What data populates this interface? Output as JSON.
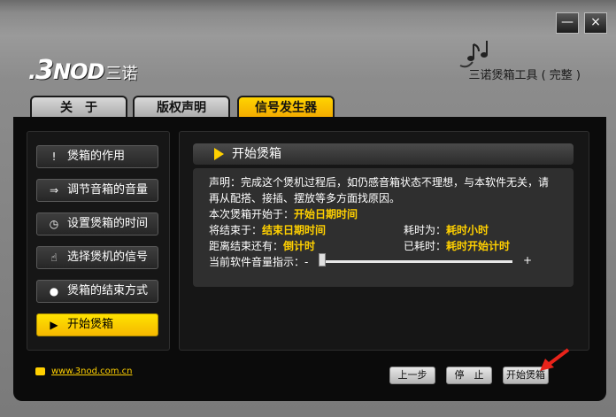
{
  "window": {
    "minimize_label": "—",
    "close_label": "×"
  },
  "logo": {
    "brand_prefix": ".",
    "brand_digit": "3",
    "brand_suffix": "NOD",
    "brand_cn": "三诺"
  },
  "app_title": "三诺煲箱工具 ( 完整 )",
  "tabs": [
    {
      "label": "关　于",
      "active": false
    },
    {
      "label": "版权声明",
      "active": false
    },
    {
      "label": "信号发生器",
      "active": true
    }
  ],
  "sidebar": {
    "items": [
      {
        "icon": "!",
        "label": "煲箱的作用"
      },
      {
        "icon": "⇒",
        "label": "调节音箱的音量"
      },
      {
        "icon": "◷",
        "label": "设置煲箱的时间"
      },
      {
        "icon": "☝",
        "label": "选择煲机的信号"
      },
      {
        "icon": "●",
        "label": "煲箱的结束方式"
      },
      {
        "icon": "▶",
        "label": "开始煲箱"
      }
    ]
  },
  "section": {
    "title": "开始煲箱"
  },
  "info": {
    "statement_line1": "声明：完成这个煲机过程后，如仍感音箱状态不理想，与本软件无关，请",
    "statement_line2": "再从配搭、接插、摆放等多方面找原因。",
    "start_label": "本次煲箱开始于：",
    "start_value": "开始日期时间",
    "end_label": "将结束于：",
    "end_value": "结束日期时间",
    "duration_label": "耗时为：",
    "duration_value": "耗时小时",
    "remaining_label": "距离结束还有：",
    "remaining_value": "倒计时",
    "elapsed_label": "已耗时：",
    "elapsed_value": "耗时开始计时",
    "volume_label": "当前软件音量指示：-",
    "volume_plus": "+",
    "volume_level": 0.0
  },
  "footer": {
    "url": "www.3nod.com.cn",
    "prev_label": "上一步",
    "stop_label": "停　止",
    "start_label": "开始煲箱"
  },
  "colors": {
    "accent": "#ffd000",
    "panel": "#0b0b0b",
    "arrow": "#e8231a"
  }
}
